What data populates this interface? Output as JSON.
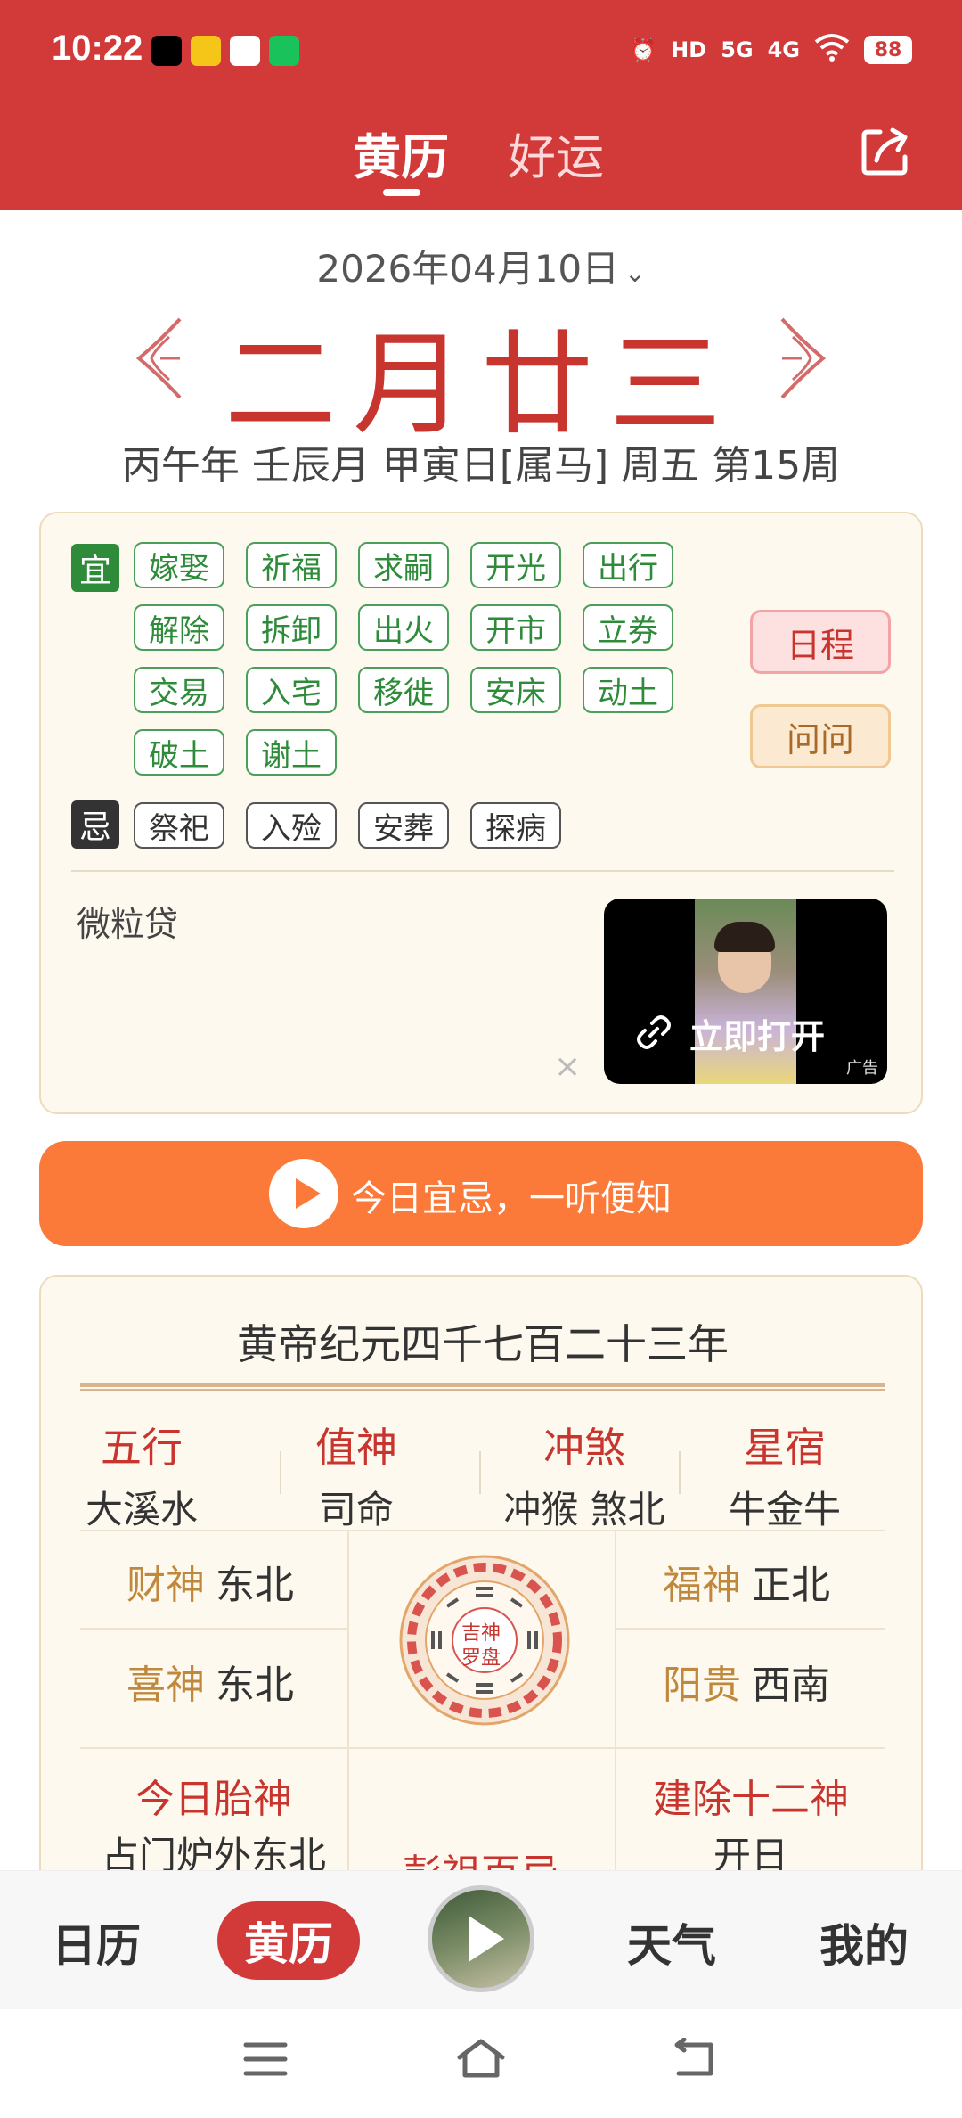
{
  "status_bar": {
    "time": "10:22",
    "battery": "88",
    "hd_label": "HD",
    "signal1": "5G",
    "signal2": "4G"
  },
  "header": {
    "tabs": [
      "黄历",
      "好运"
    ],
    "active_tab": "黄历"
  },
  "date": {
    "selected": "2026年04月10日",
    "lunar": "二月廿三",
    "ganzhi": "丙午年 壬辰月 甲寅日[属马] 周五 第15周"
  },
  "yiji": {
    "yi_label": "宜",
    "yi": [
      "嫁娶",
      "祈福",
      "求嗣",
      "开光",
      "出行",
      "解除",
      "拆卸",
      "出火",
      "开市",
      "立券",
      "交易",
      "入宅",
      "移徙",
      "安床",
      "动土",
      "破土",
      "谢土"
    ],
    "ji_label": "忌",
    "ji": [
      "祭祀",
      "入殓",
      "安葬",
      "探病"
    ],
    "schedule_btn": "日程",
    "ask_btn": "问问"
  },
  "ad": {
    "title": "微粒贷",
    "open_label": "立即打开",
    "tag": "广告",
    "close": "×"
  },
  "listen": {
    "label": "今日宜忌，一听便知"
  },
  "info": {
    "era": "黄帝纪元四千七百二十三年",
    "columns": [
      {
        "label": "五行",
        "value": "大溪水"
      },
      {
        "label": "值神",
        "value": "司命"
      },
      {
        "label": "冲煞",
        "value": "冲猴 煞北"
      },
      {
        "label": "星宿",
        "value": "牛金牛"
      }
    ],
    "gods": [
      {
        "label": "财神",
        "value": "东北"
      },
      {
        "label": "喜神",
        "value": "东北"
      },
      {
        "label": "福神",
        "value": "正北"
      },
      {
        "label": "阳贵",
        "value": "西南"
      }
    ],
    "compass": {
      "line1": "吉神",
      "line2": "罗盘"
    },
    "taishen_label": "今日胎神",
    "taishen_value": "占门炉外东北",
    "pengzu_label": "彭祖百忌",
    "jianchu_label": "建除十二神",
    "jianchu_value": "开日"
  },
  "bottom_nav": {
    "items": [
      "日历",
      "黄历",
      "天气",
      "我的"
    ],
    "active": "黄历"
  },
  "colors": {
    "brand_red": "#d23a3a",
    "orange": "#fb7a3a",
    "good_green": "#2e8b3a",
    "gold": "#c0883c"
  }
}
